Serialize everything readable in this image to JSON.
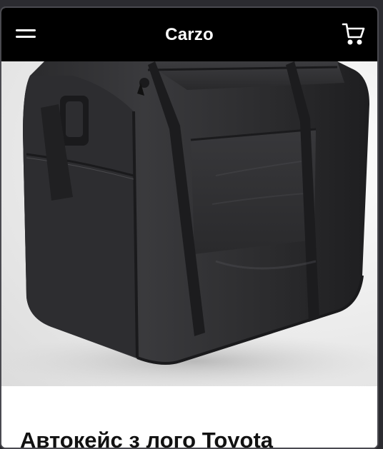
{
  "header": {
    "logo": "Carzo",
    "menu_icon": "hamburger-menu-icon",
    "cart_icon": "shopping-cart-icon"
  },
  "hero": {
    "image": "black duffel bag product photo"
  },
  "product": {
    "title": "Автокейс з лого Toyota"
  },
  "colors": {
    "header_bg": "#000000",
    "page_bg": "#2b2b30",
    "accent_text": "#ffffff"
  }
}
